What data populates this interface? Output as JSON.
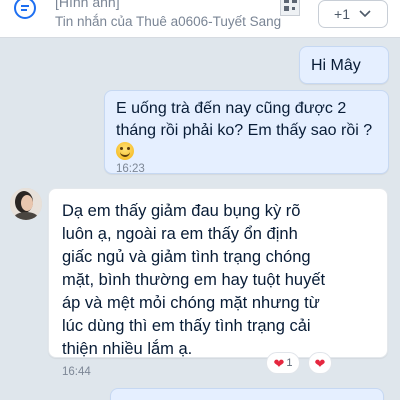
{
  "pinned": {
    "title": "[Hình ảnh]",
    "subtitle": "Tin nhắn của Thuê a0606-Tuyết Sang",
    "more_count": "+1"
  },
  "messages": [
    {
      "side": "mine",
      "text": "Hi Mây"
    },
    {
      "side": "mine",
      "text_lines": [
        "E uống trà đến nay cũng được 2",
        "tháng rồi phải ko? Em thấy sao rồi ?"
      ],
      "emoji": "smile-emoji",
      "time": "16:23"
    },
    {
      "side": "theirs",
      "text_lines": [
        "Dạ em thấy giảm đau bụng kỳ rõ",
        "luôn ạ, ngoài ra em thấy ổn định",
        "giấc ngủ và giảm tình trạng chóng",
        "mặt, bình thường em hay tuột huyết",
        "áp và mệt mỏi chóng mặt nhưng từ",
        "lúc dùng thì em thấy tình trạng cải",
        "thiện nhiều lắm ạ."
      ],
      "time": "16:44"
    }
  ],
  "reactions": {
    "heart_count": "1"
  },
  "colors": {
    "mine_bubble": "#e5efff",
    "theirs_bubble": "#ffffff",
    "background": "#dfe6ec",
    "heart": "#e5273f"
  }
}
